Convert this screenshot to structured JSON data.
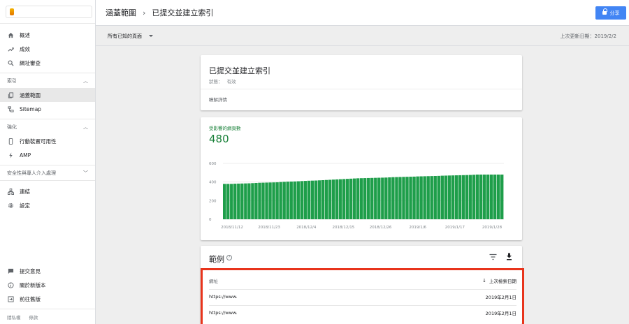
{
  "sidebar": {
    "top_items": [
      {
        "label": "概述",
        "icon": "home-icon"
      },
      {
        "label": "成效",
        "icon": "trending-up-icon"
      },
      {
        "label": "網址審查",
        "icon": "search-icon"
      }
    ],
    "index_section": {
      "title": "索引",
      "items": [
        {
          "label": "涵蓋範圍",
          "icon": "copy-icon",
          "active": true
        },
        {
          "label": "Sitemap",
          "icon": "sitemap-icon"
        }
      ]
    },
    "enhance_section": {
      "title": "強化",
      "items": [
        {
          "label": "行動裝置可用性",
          "icon": "phone-icon"
        },
        {
          "label": "AMP",
          "icon": "amp-bolt-icon"
        }
      ]
    },
    "security_section": {
      "title": "安全性與專人介入處理"
    },
    "other_items": [
      {
        "label": "連結",
        "icon": "links-icon"
      },
      {
        "label": "設定",
        "icon": "gear-icon"
      }
    ],
    "bottom_items": [
      {
        "label": "提交意見",
        "icon": "feedback-icon"
      },
      {
        "label": "關於新版本",
        "icon": "info-icon"
      },
      {
        "label": "前往舊版",
        "icon": "exit-icon"
      }
    ],
    "footer": {
      "privacy": "隱私權",
      "terms": "條款"
    }
  },
  "header": {
    "breadcrumb_parent": "涵蓋範圍",
    "breadcrumb_separator": "›",
    "breadcrumb_current": "已提交並建立索引",
    "share_label": "分享"
  },
  "filter": {
    "selected": "所有已知的頁面",
    "updated_label": "上次更新日期：2019/2/2"
  },
  "status_card": {
    "title": "已提交並建立索引",
    "status_label": "狀態：",
    "status_value": "有效",
    "learn_more": "瞭解詳情"
  },
  "metric": {
    "label": "受影響的網頁數",
    "value": "480"
  },
  "colors": {
    "accent_green": "#188038",
    "bar_green": "#1e9e4a",
    "share_blue": "#4285f4",
    "highlight_red": "#e8341c"
  },
  "chart_data": {
    "type": "bar",
    "ylim": [
      0,
      600
    ],
    "y_ticks": [
      "600",
      "400",
      "200",
      "0"
    ],
    "x_ticks": [
      "2018/11/12",
      "2018/11/23",
      "2018/12/4",
      "2018/12/15",
      "2018/12/26",
      "2019/1/6",
      "2019/1/17",
      "2019/1/28"
    ],
    "values": [
      380,
      380,
      380,
      382,
      383,
      384,
      385,
      386,
      388,
      390,
      392,
      393,
      394,
      395,
      396,
      397,
      400,
      402,
      404,
      405,
      406,
      408,
      410,
      412,
      414,
      415,
      416,
      418,
      420,
      422,
      424,
      426,
      428,
      430,
      432,
      434,
      436,
      438,
      440,
      441,
      442,
      443,
      444,
      445,
      446,
      447,
      448,
      450,
      452,
      453,
      454,
      455,
      456,
      457,
      458,
      460,
      461,
      462,
      463,
      464,
      465,
      466,
      468,
      469,
      470,
      471,
      472,
      473,
      474,
      475,
      476,
      478,
      480,
      480,
      480,
      480,
      480,
      480,
      480,
      480
    ]
  },
  "table": {
    "title": "範例",
    "help_icon": "?",
    "col_url": "網址",
    "col_date": "上次檢索日期",
    "sort_arrow": "↓",
    "rows": [
      {
        "url": "https://www.",
        "date": "2019年2月1日"
      },
      {
        "url": "https://www.",
        "date": "2019年2月1日"
      }
    ]
  }
}
